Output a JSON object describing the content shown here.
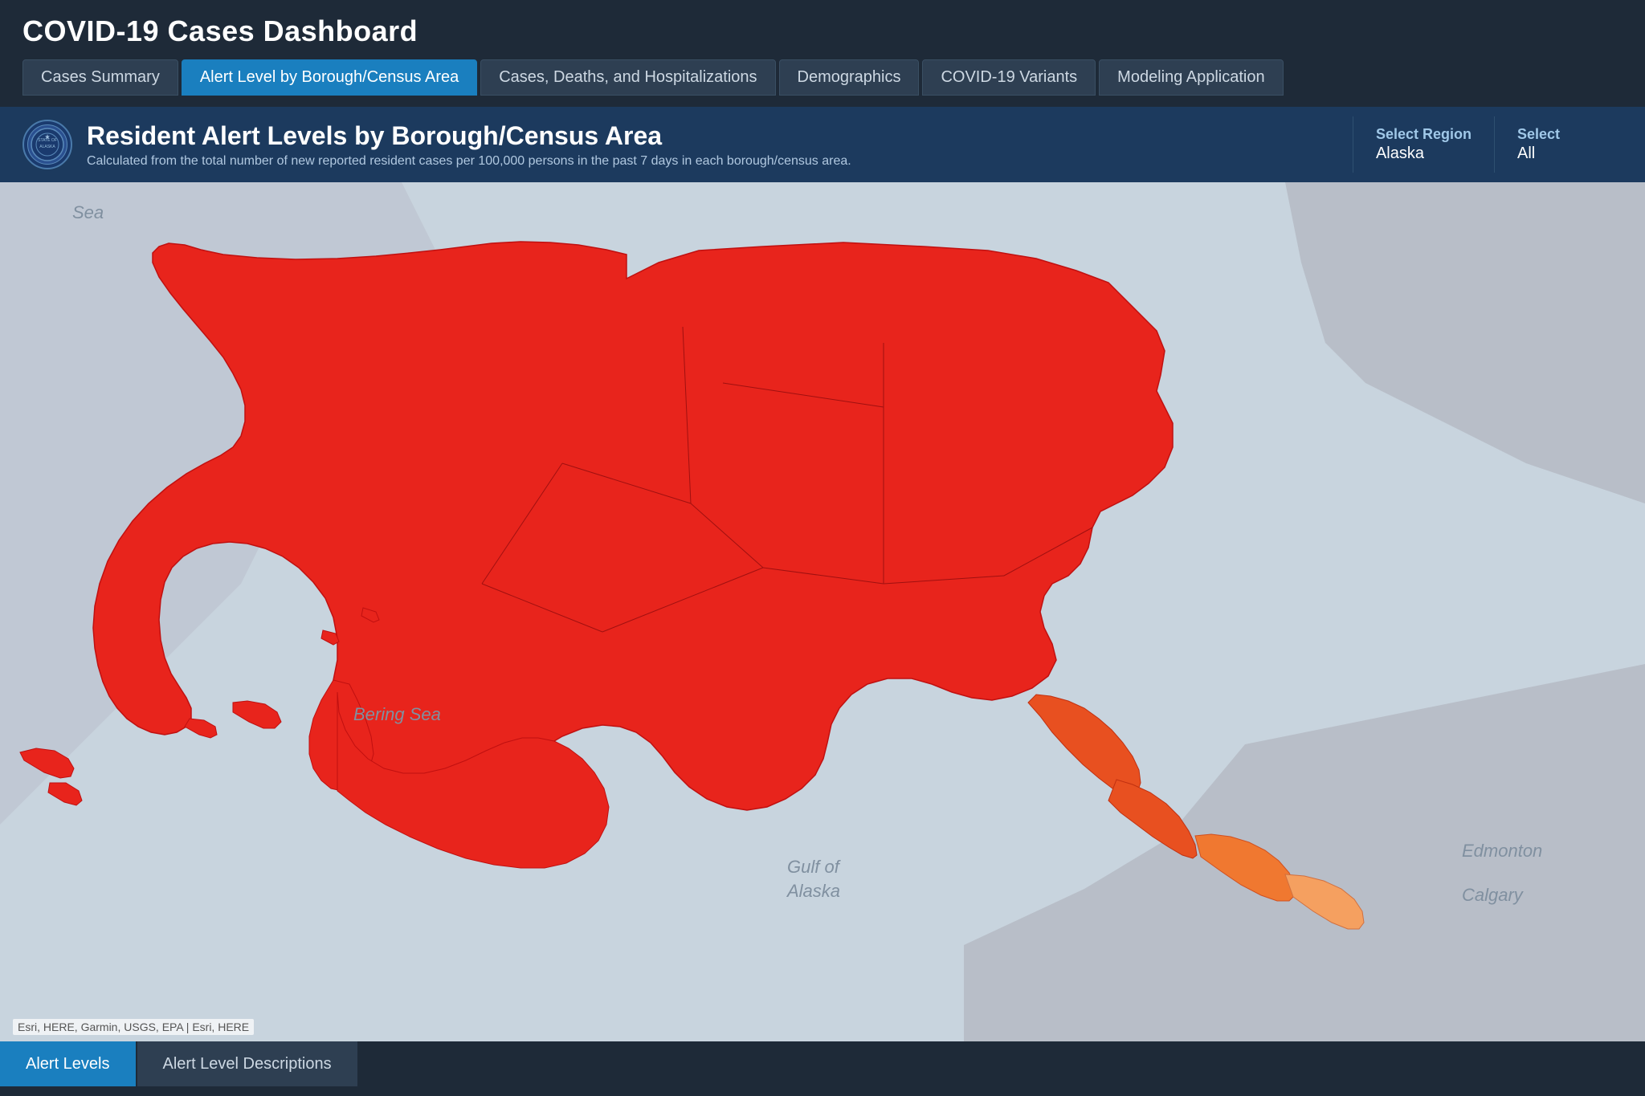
{
  "app": {
    "title": "COVID-19 Cases Dashboard"
  },
  "nav": {
    "tabs": [
      {
        "id": "cases-summary",
        "label": "Cases Summary",
        "active": false
      },
      {
        "id": "alert-level",
        "label": "Alert Level by Borough/Census Area",
        "active": true
      },
      {
        "id": "cases-deaths",
        "label": "Cases, Deaths, and Hospitalizations",
        "active": false
      },
      {
        "id": "demographics",
        "label": "Demographics",
        "active": false
      },
      {
        "id": "covid-variants",
        "label": "COVID-19 Variants",
        "active": false
      },
      {
        "id": "modeling",
        "label": "Modeling Application",
        "active": false
      }
    ]
  },
  "banner": {
    "title": "Resident Alert Levels by Borough/Census Area",
    "subtitle": "Calculated from the total number of new reported resident cases per 100,000 persons in the past 7 days in each borough/census area.",
    "seal_text": "STATE OF ALASKA"
  },
  "select_region": {
    "label": "Select Region",
    "value": "Alaska"
  },
  "select_all": {
    "label": "Select",
    "value": "All"
  },
  "map": {
    "attribution": "Esri, HERE, Garmin, USGS, EPA | Esri, HERE",
    "labels": {
      "sea": "Sea",
      "bering_sea": "Bering Sea",
      "gulf_of_alaska_line1": "Gulf of",
      "gulf_of_alaska_line2": "Alaska",
      "edmonton": "Edmonton",
      "calgary": "Calgary"
    }
  },
  "bottom_tabs": [
    {
      "id": "alert-levels",
      "label": "Alert Levels",
      "active": true
    },
    {
      "id": "alert-descriptions",
      "label": "Alert Level Descriptions",
      "active": false
    }
  ],
  "colors": {
    "red": "#e8241c",
    "orange_red": "#e85020",
    "orange": "#f07830",
    "light_orange": "#f5a060",
    "background_map": "#d8dde6",
    "water": "#c5cdd8",
    "land_outside": "#b8bec8"
  }
}
